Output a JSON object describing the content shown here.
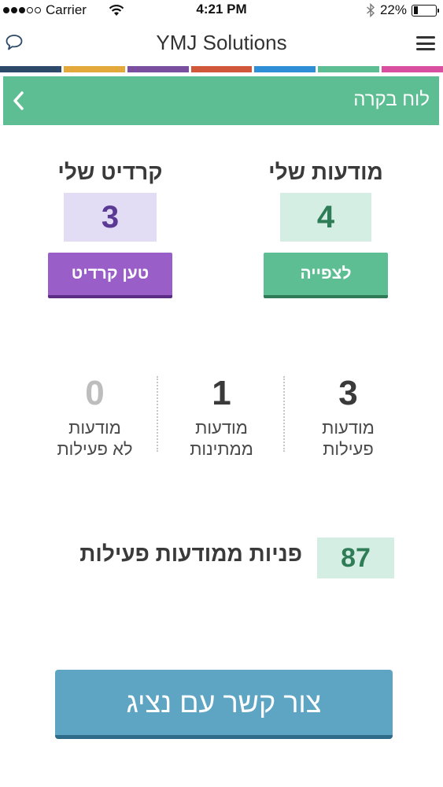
{
  "status_bar": {
    "carrier": "Carrier",
    "time": "4:21 PM",
    "battery": "22%",
    "battery_level": 0.22
  },
  "header": {
    "title": "YMJ Solutions",
    "left_icon": "chat-bubble-icon",
    "right_icon": "hamburger-menu-icon"
  },
  "color_strip": [
    "#2e4a6b",
    "#e3a93a",
    "#7a4fa0",
    "#d0573a",
    "#2e8fd6",
    "#5dbe93",
    "#d94fa0"
  ],
  "page_bar": {
    "title": "לוח בקרה",
    "back_icon": "chevron-left-icon",
    "color": "#5dbe93"
  },
  "my_ads": {
    "label": "מודעות שלי",
    "count": "4",
    "button_label": "לצפייה",
    "box_color": "#d5eee3",
    "text_color": "#2e7d57",
    "button_color": "#5dbe93",
    "button_shadow": "#2f7a57"
  },
  "my_credit": {
    "label": "קרדיט שלי",
    "count": "3",
    "button_label": "טען קרדיט",
    "box_color": "#e2dcf5",
    "text_color": "#5b3a96",
    "button_color": "#9a5ec9",
    "button_shadow": "#5b2d85"
  },
  "ad_stats": [
    {
      "number": "3",
      "caption": "מודעות\nפעילות",
      "color": "#3a3a3a"
    },
    {
      "number": "1",
      "caption": "מודעות\nממתינות",
      "color": "#3a3a3a"
    },
    {
      "number": "0",
      "caption": "מודעות\nלא פעילות",
      "color": "#bdbdbd"
    }
  ],
  "inquiries": {
    "label": "פניות ממודעות פעילות",
    "count": "87"
  },
  "contact_button": {
    "label": "צור קשר עם נציג"
  }
}
